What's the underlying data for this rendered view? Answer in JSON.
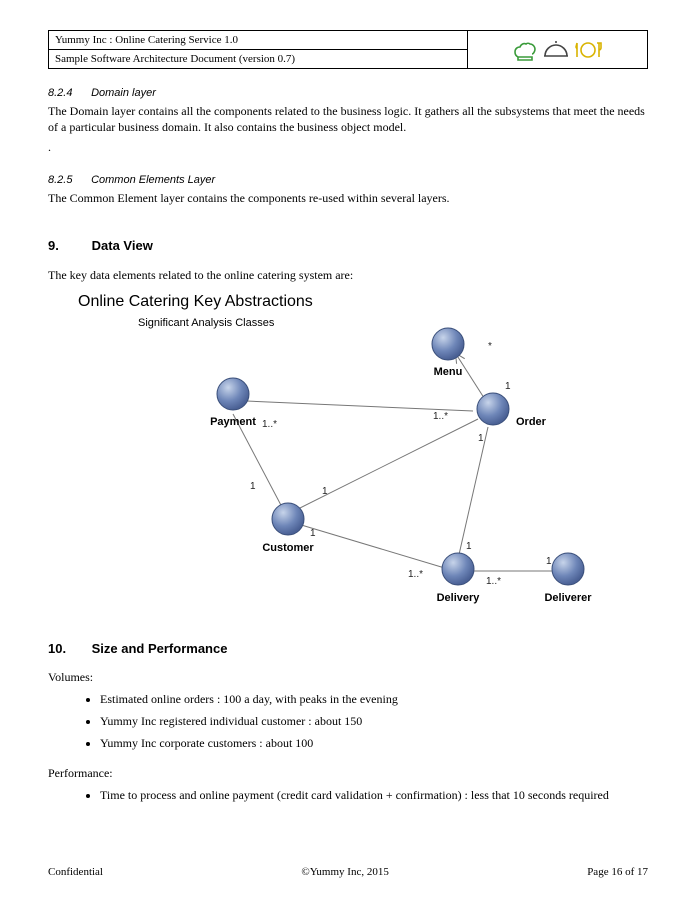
{
  "header": {
    "title": "Yummy Inc : Online Catering Service 1.0",
    "subtitle": "Sample Software Architecture Document (version 0.7)"
  },
  "sections": {
    "s824": {
      "num": "8.2.4",
      "title": "Domain layer",
      "body": "The Domain layer contains all the components related to the business logic. It gathers all the subsystems that meet the needs of a particular business domain. It also contains the business object model."
    },
    "s825": {
      "num": "8.2.5",
      "title": "Common Elements Layer",
      "body": "The Common Element layer contains the components re-used within several layers."
    },
    "s9": {
      "num": "9.",
      "title": "Data View",
      "intro": "The key data elements related to the online catering system are:"
    },
    "s10": {
      "num": "10.",
      "title": "Size and Performance",
      "volumes_label": "Volumes:",
      "volumes": [
        "Estimated online orders : 100 a day, with peaks in the evening",
        "Yummy Inc registered individual customer : about 150",
        "Yummy Inc corporate customers : about 100"
      ],
      "perf_label": "Performance:",
      "perf": [
        "Time to process and online payment (credit card validation + confirmation) : less that 10 seconds required"
      ]
    }
  },
  "diagram": {
    "title": "Online Catering Key Abstractions",
    "subtitle": "Significant Analysis Classes",
    "nodes": {
      "payment": "Payment",
      "menu": "Menu",
      "order": "Order",
      "customer": "Customer",
      "delivery": "Delivery",
      "deliverer": "Deliverer"
    },
    "multiplicities": {
      "payment_order": "1..*",
      "menu_order_star": "*",
      "menu_order_one": "1",
      "order_payment_oneStar": "1..*",
      "order_delivery_one": "1",
      "customer_payment_one": "1",
      "customer_order_one": "1",
      "customer_delivery_one": "1",
      "delivery_customer": "1..*",
      "delivery_order": "1",
      "delivery_deliverer": "1..*",
      "deliverer_delivery_one": "1"
    }
  },
  "footer": {
    "left": "Confidential",
    "center": "©Yummy Inc, 2015",
    "right": "Page 16 of 17"
  }
}
